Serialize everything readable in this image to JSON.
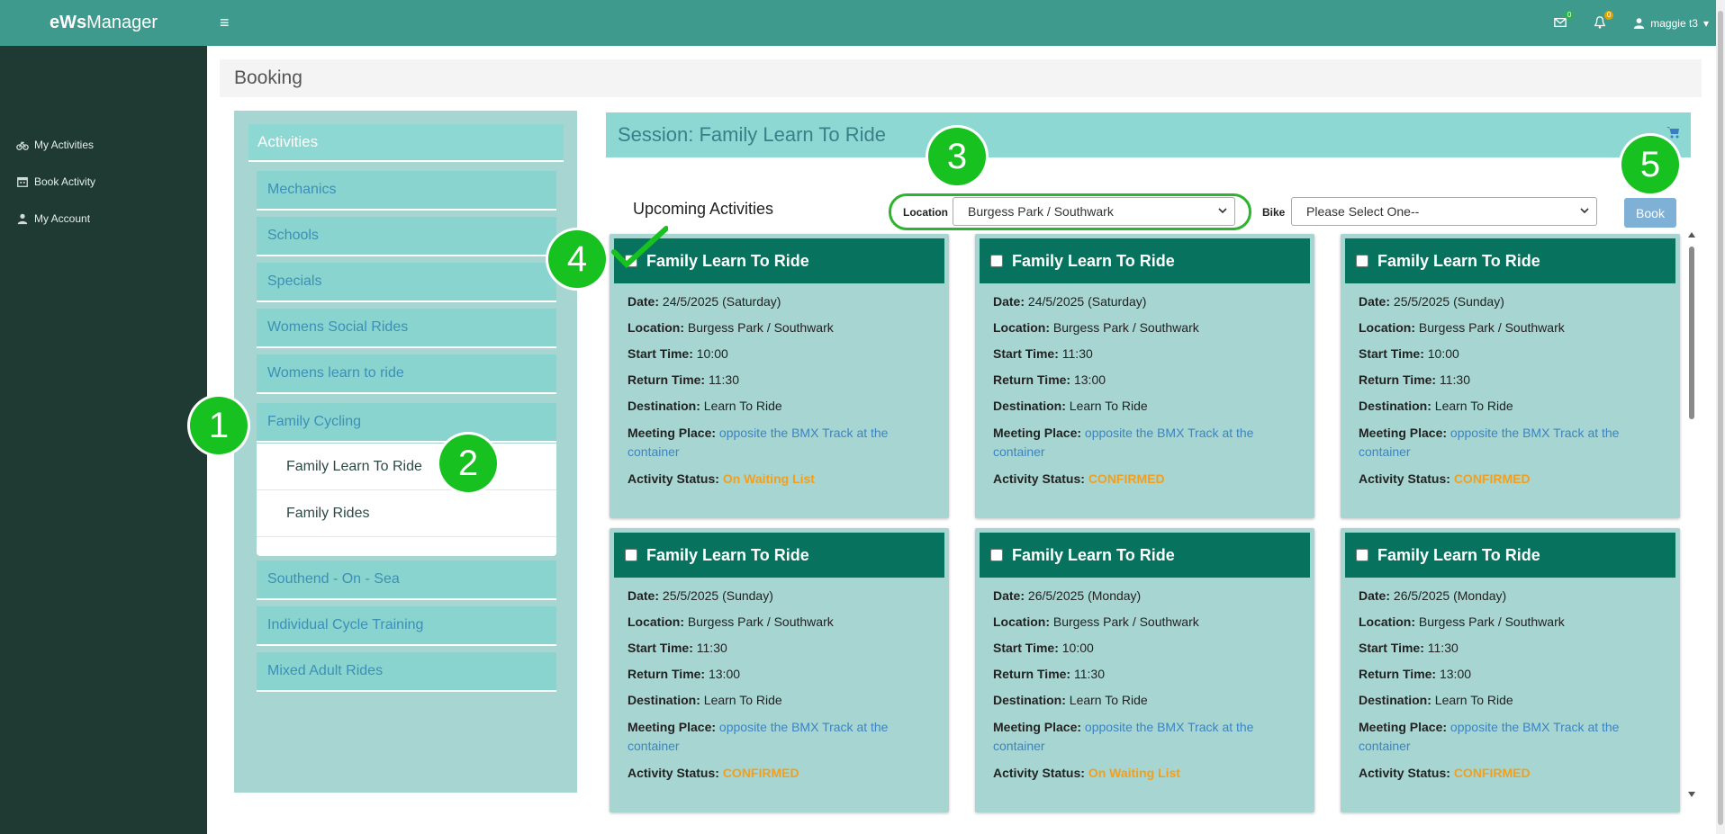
{
  "brand": {
    "prefix": "eWs",
    "suffix": "Manager"
  },
  "sidebar": {
    "items": [
      {
        "label": "My Activities",
        "icon": "bicycle-icon"
      },
      {
        "label": "Book Activity",
        "icon": "calendar-icon"
      },
      {
        "label": "My Account",
        "icon": "user-icon"
      }
    ]
  },
  "topbar": {
    "mail_badge": "0",
    "bell_badge": "0",
    "user_name": "maggie t3"
  },
  "page": {
    "title": "Booking"
  },
  "activities": {
    "heading": "Activities",
    "categories": [
      "Mechanics",
      "Schools",
      "Specials",
      "Womens Social Rides",
      "Womens learn to ride",
      "Family Cycling",
      "Southend - On - Sea",
      "Individual Cycle Training",
      "Mixed Adult Rides"
    ],
    "subitems": [
      "Family Learn To Ride",
      "Family Rides"
    ]
  },
  "session": {
    "title": "Session: Family Learn To Ride",
    "upcoming_label": "Upcoming Activities",
    "location_label": "Location",
    "location_value": "Burgess Park / Southwark",
    "bike_label": "Bike",
    "bike_value": "Please Select One--",
    "book_label": "Book"
  },
  "labels": {
    "date": "Date:",
    "location": "Location:",
    "start": "Start Time:",
    "return": "Return Time:",
    "destination": "Destination:",
    "meeting": "Meeting Place:",
    "status": "Activity Status:"
  },
  "cards": [
    {
      "title": "Family Learn To Ride",
      "date": "24/5/2025 (Saturday)",
      "location": "Burgess Park / Southwark",
      "start": "10:00",
      "return": "11:30",
      "destination": "Learn To Ride",
      "meeting": "opposite the BMX Track at the container",
      "status": "On Waiting List"
    },
    {
      "title": "Family Learn To Ride",
      "date": "24/5/2025 (Saturday)",
      "location": "Burgess Park / Southwark",
      "start": "11:30",
      "return": "13:00",
      "destination": "Learn To Ride",
      "meeting": "opposite the BMX Track at the container",
      "status": "CONFIRMED"
    },
    {
      "title": "Family Learn To Ride",
      "date": "25/5/2025 (Sunday)",
      "location": "Burgess Park / Southwark",
      "start": "10:00",
      "return": "11:30",
      "destination": "Learn To Ride",
      "meeting": "opposite the BMX Track at the container",
      "status": "CONFIRMED"
    },
    {
      "title": "Family Learn To Ride",
      "date": "25/5/2025 (Sunday)",
      "location": "Burgess Park / Southwark",
      "start": "11:30",
      "return": "13:00",
      "destination": "Learn To Ride",
      "meeting": "opposite the BMX Track at the container",
      "status": "CONFIRMED"
    },
    {
      "title": "Family Learn To Ride",
      "date": "26/5/2025 (Monday)",
      "location": "Burgess Park / Southwark",
      "start": "10:00",
      "return": "11:30",
      "destination": "Learn To Ride",
      "meeting": "opposite the BMX Track at the container",
      "status": "On Waiting List"
    },
    {
      "title": "Family Learn To Ride",
      "date": "26/5/2025 (Monday)",
      "location": "Burgess Park / Southwark",
      "start": "11:30",
      "return": "13:00",
      "destination": "Learn To Ride",
      "meeting": "opposite the BMX Track at the container",
      "status": "CONFIRMED"
    }
  ],
  "markers": [
    "1",
    "2",
    "3",
    "4",
    "5"
  ],
  "colors": {
    "topbar": "#3e9a8c",
    "sidebar": "#1e3a32",
    "card_head": "#07735f",
    "marker": "#17c120",
    "status": "#f0a01e"
  }
}
